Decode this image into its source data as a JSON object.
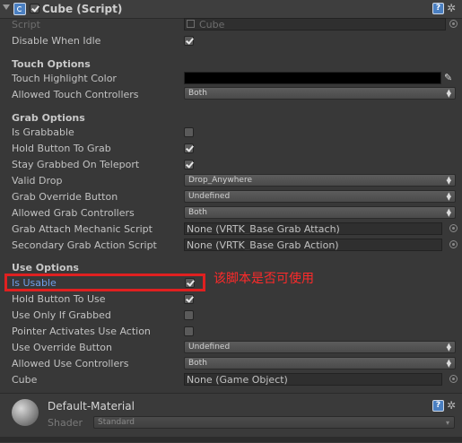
{
  "header": {
    "title": "Cube (Script)",
    "enabled": true
  },
  "script_row": {
    "label": "Script",
    "value": "Cube"
  },
  "disable_when_idle": {
    "label": "Disable When Idle",
    "checked": true
  },
  "touch_options": {
    "heading": "Touch Options",
    "highlight_color_label": "Touch Highlight Color",
    "highlight_color": "#000000",
    "allowed_controllers_label": "Allowed Touch Controllers",
    "allowed_controllers_value": "Both"
  },
  "grab_options": {
    "heading": "Grab Options",
    "is_grabbable": {
      "label": "Is Grabbable",
      "checked": false
    },
    "hold_button_to_grab": {
      "label": "Hold Button To Grab",
      "checked": true
    },
    "stay_grabbed": {
      "label": "Stay Grabbed On Teleport",
      "checked": true
    },
    "valid_drop": {
      "label": "Valid Drop",
      "value": "Drop_Anywhere"
    },
    "grab_override": {
      "label": "Grab Override Button",
      "value": "Undefined"
    },
    "allowed_grab": {
      "label": "Allowed Grab Controllers",
      "value": "Both"
    },
    "grab_attach": {
      "label": "Grab Attach Mechanic Script",
      "value": "None (VRTK_Base Grab Attach)"
    },
    "secondary_grab": {
      "label": "Secondary Grab Action Script",
      "value": "None (VRTK_Base Grab Action)"
    }
  },
  "use_options": {
    "heading": "Use Options",
    "is_usable": {
      "label": "Is Usable",
      "checked": true
    },
    "hold_button_to_use": {
      "label": "Hold Button To Use",
      "checked": true
    },
    "use_only_if_grabbed": {
      "label": "Use Only If Grabbed",
      "checked": false
    },
    "pointer_activates": {
      "label": "Pointer Activates Use Action",
      "checked": false
    },
    "use_override": {
      "label": "Use Override Button",
      "value": "Undefined"
    },
    "allowed_use": {
      "label": "Allowed Use Controllers",
      "value": "Both"
    },
    "cube": {
      "label": "Cube",
      "value": "None (Game Object)"
    }
  },
  "annotation": "该脚本是否可使用",
  "material": {
    "name": "Default-Material",
    "shader_label": "Shader",
    "shader_value": "Standard"
  },
  "icons": {
    "help": "?",
    "gear": "✲",
    "dropdown_arrow": "▲▼",
    "eyedropper": "✎"
  },
  "colors": {
    "annotation": "#ff2a2a",
    "selected_label": "#6f9fe8",
    "help_icon": "#4a7fc1"
  }
}
